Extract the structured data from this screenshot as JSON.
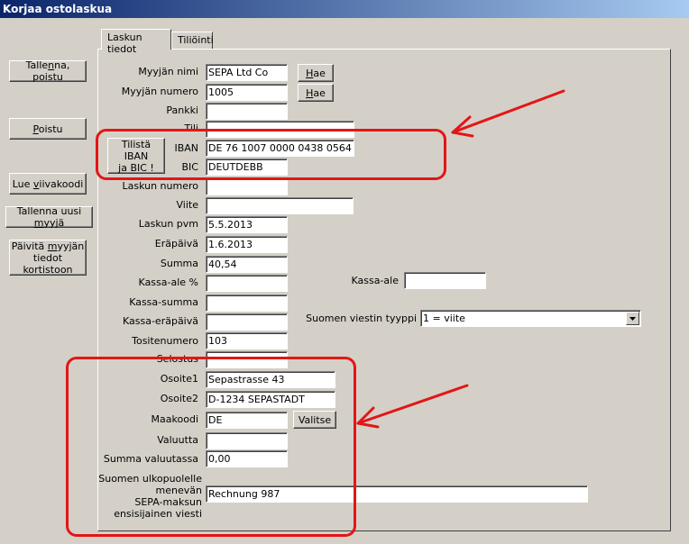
{
  "window": {
    "title": "Korjaa ostolaskua"
  },
  "sidebar": {
    "save_exit": {
      "pre": "Talle",
      "u": "n",
      "post": "na, poistu"
    },
    "exit": {
      "pre": "",
      "u": "P",
      "post": "oistu"
    },
    "read_barcode": {
      "pre": "Lue ",
      "u": "v",
      "post": "iivakoodi"
    },
    "save_new_seller": {
      "pre": "Tallenna uusi ",
      "u": "m",
      "post": "yyjä"
    },
    "update_seller_l1": {
      "pre": "Päivitä ",
      "u": "m",
      "post": "yyjän"
    },
    "update_seller_l2": "tiedot kortistoon"
  },
  "tabs": [
    {
      "label": "Laskun tiedot"
    },
    {
      "label": "Tiliöinti"
    }
  ],
  "form": {
    "myyjan_nimi": {
      "label": "Myyjän nimi",
      "value": "SEPA Ltd Co"
    },
    "myyjan_numero": {
      "label": "Myyjän numero",
      "value": "1005"
    },
    "hae1": {
      "pre": "",
      "u": "H",
      "post": "ae"
    },
    "hae2": {
      "pre": "",
      "u": "H",
      "post": "ae"
    },
    "pankki": {
      "label": "Pankki",
      "value": ""
    },
    "tili": {
      "label": "Tili",
      "value": ""
    },
    "iban_button_l1": "Tilistä IBAN",
    "iban_button_l2": "ja BIC !",
    "iban": {
      "label": "IBAN",
      "value": "DE 76 1007 0000 0438 0564"
    },
    "bic": {
      "label": "BIC",
      "value": "DEUTDEBB"
    },
    "laskun_numero": {
      "label": "Laskun numero",
      "value": ""
    },
    "viite": {
      "label": "Viite",
      "value": ""
    },
    "laskun_pvm": {
      "label": "Laskun pvm",
      "value": "5.5.2013"
    },
    "erapaiva": {
      "label": "Eräpäivä",
      "value": "1.6.2013"
    },
    "summa": {
      "label": "Summa",
      "value": "40,54"
    },
    "kassa_ale_pct": {
      "label": "Kassa-ale %",
      "value": ""
    },
    "kassa_summa": {
      "label": "Kassa-summa",
      "value": ""
    },
    "kassa_erapaiva": {
      "label": "Kassa-eräpäivä",
      "value": ""
    },
    "tositenumero": {
      "label": "Tositenumero",
      "value": "103"
    },
    "selostus": {
      "label": "Selostus",
      "value": ""
    },
    "kassa_ale": {
      "label": "Kassa-ale",
      "value": ""
    },
    "viestin_tyyppi": {
      "label": "Suomen viestin tyyppi",
      "value": "1 = viite"
    },
    "osoite1": {
      "label": "Osoite1",
      "value": "Sepastrasse 43"
    },
    "osoite2": {
      "label": "Osoite2",
      "value": "D-1234 SEPASTADT"
    },
    "maakoodi": {
      "label": "Maakoodi",
      "value": "DE"
    },
    "valitse": "Valitse",
    "valuutta": {
      "label": "Valuutta",
      "value": ""
    },
    "summa_valuutassa": {
      "label": "Summa valuutassa",
      "value": "0,00"
    },
    "sepa_viesti": {
      "label_l1": "Suomen ulkopuolelle",
      "label_l2": "menevän",
      "label_l3": "SEPA-maksun",
      "label_l4": "ensisijainen viesti",
      "value": "Rechnung 987"
    }
  },
  "annotation_color": "#e31616"
}
